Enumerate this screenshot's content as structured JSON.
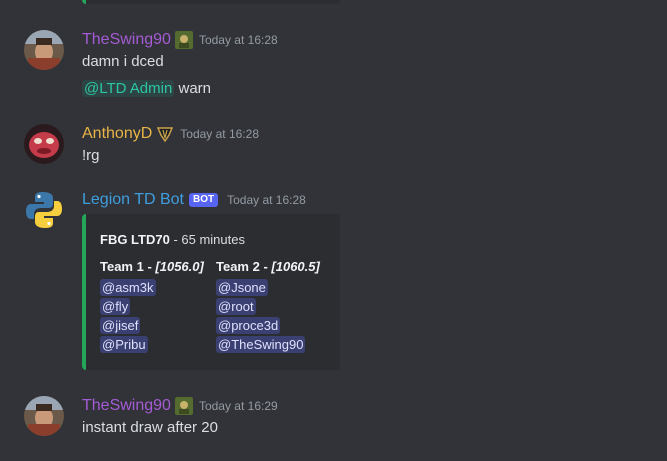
{
  "messages": [
    {
      "username": "TheSwing90",
      "username_color": "#a55bd4",
      "timestamp": "Today at 16:28",
      "lines": [
        "damn i dced"
      ],
      "mention_line": {
        "mention": "@LTD Admin",
        "text": "warn"
      }
    },
    {
      "username": "AnthonyD",
      "username_color": "#e8b447",
      "timestamp": "Today at 16:28",
      "lines": [
        "!rg"
      ]
    },
    {
      "username": "Legion TD Bot",
      "username_color": "#3e9edf",
      "bot_tag": "BOT",
      "timestamp": "Today at 16:28",
      "embed": {
        "accent_color": "#23a55a",
        "title_bold": "FBG LTD70",
        "title_rest": "- 65 minutes",
        "team1": {
          "name": "Team 1 -",
          "elo": "[1056.0]",
          "members": [
            "@asm3k",
            "@fly",
            "@jisef",
            "@Pribu"
          ]
        },
        "team2": {
          "name": "Team 2 -",
          "elo": "[1060.5]",
          "members": [
            "@Jsone",
            "@root",
            "@proce3d",
            "@TheSwing90"
          ]
        }
      }
    },
    {
      "username": "TheSwing90",
      "username_color": "#a55bd4",
      "timestamp": "Today at 16:29",
      "lines": [
        "instant draw after 20"
      ]
    }
  ],
  "icons": {
    "avatar_1": "avatar-icon",
    "role_badge_1": "role-badge-icon",
    "avatar_2": "avatar-icon",
    "role_badge_2": "crown-badge-icon",
    "avatar_3": "python-logo-icon"
  }
}
